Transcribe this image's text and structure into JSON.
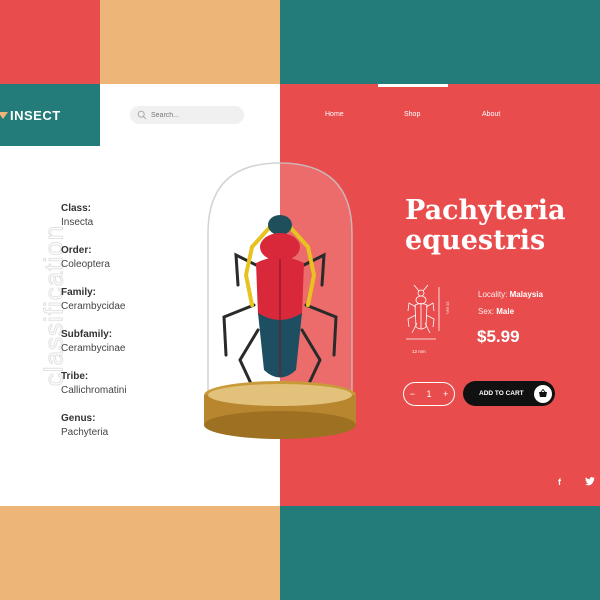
{
  "brand": {
    "logo_text": "INSECT"
  },
  "search": {
    "placeholder": "Search..."
  },
  "nav": {
    "items": [
      "Home",
      "Shop",
      "About"
    ],
    "active": "Shop"
  },
  "sidebar": {
    "vertical_title": "classification"
  },
  "taxonomy": [
    {
      "label": "Class:",
      "value": "Insecta"
    },
    {
      "label": "Order:",
      "value": "Coleoptera"
    },
    {
      "label": "Family:",
      "value": "Cerambycidae"
    },
    {
      "label": "Subfamily:",
      "value": "Cerambycinae"
    },
    {
      "label": "Tribe:",
      "value": "Callichromatini"
    },
    {
      "label": "Genus:",
      "value": "Pachyteria"
    }
  ],
  "product": {
    "title_line1": "Pachyteria",
    "title_line2": "equestris",
    "dimension_height": "32 mm",
    "dimension_width": "12 mm",
    "locality_label": "Locality:",
    "locality_value": "Malaysia",
    "sex_label": "Sex:",
    "sex_value": "Male",
    "price": "$5.99"
  },
  "cart": {
    "qty_minus": "−",
    "qty_value": "1",
    "qty_plus": "+",
    "add_label": "ADD TO CART"
  },
  "social": {
    "facebook": "f",
    "twitter": "twitter-icon"
  },
  "colors": {
    "red": "#E84C4C",
    "teal": "#237C7A",
    "tan": "#EDB577",
    "white": "#FFFFFF",
    "black": "#111111"
  }
}
